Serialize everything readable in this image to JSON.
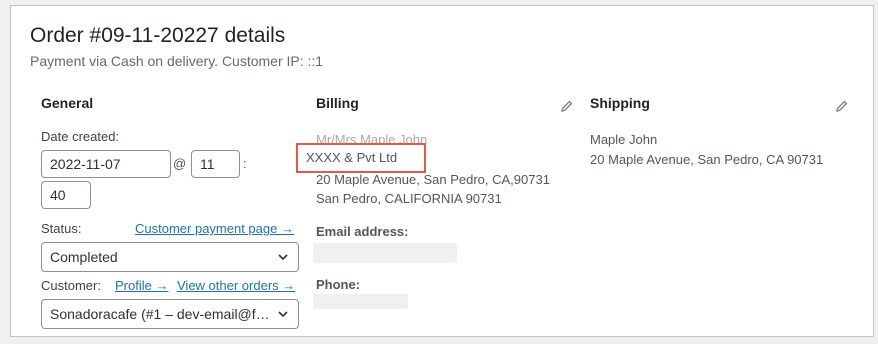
{
  "order": {
    "title": "Order #09-11-20227 details",
    "subtitle": "Payment via Cash on delivery. Customer IP: ::1"
  },
  "general": {
    "heading": "General",
    "date_label": "Date created:",
    "date_value": "2022-11-07",
    "at_sign": "@",
    "hour_value": "11",
    "colon": ":",
    "minute_value": "40",
    "status_label": "Status:",
    "customer_payment_link": "Customer payment page →",
    "status_value": "Completed",
    "customer_label": "Customer:",
    "profile_link": "Profile →",
    "view_orders_link": "View other orders →",
    "customer_value": "Sonadoracafe (#1 – dev-email@fl…"
  },
  "billing": {
    "heading": "Billing",
    "name_line": "Mr/Mrs Maple John",
    "company_line": "XXXX & Pvt Ltd",
    "address_line1": "20 Maple Avenue, San Pedro, CA,90731",
    "address_line2": "San Pedro, CALIFORNIA 90731",
    "email_label": "Email address:",
    "phone_label": "Phone:"
  },
  "shipping": {
    "heading": "Shipping",
    "name_line": "Maple John",
    "address_line": "20 Maple Avenue, San Pedro, CA 90731"
  },
  "icons": {
    "edit": "pencil-icon",
    "dropdown": "chevron-down-icon"
  },
  "colors": {
    "link": "#2271b1",
    "highlight_border": "#e05a4b"
  }
}
